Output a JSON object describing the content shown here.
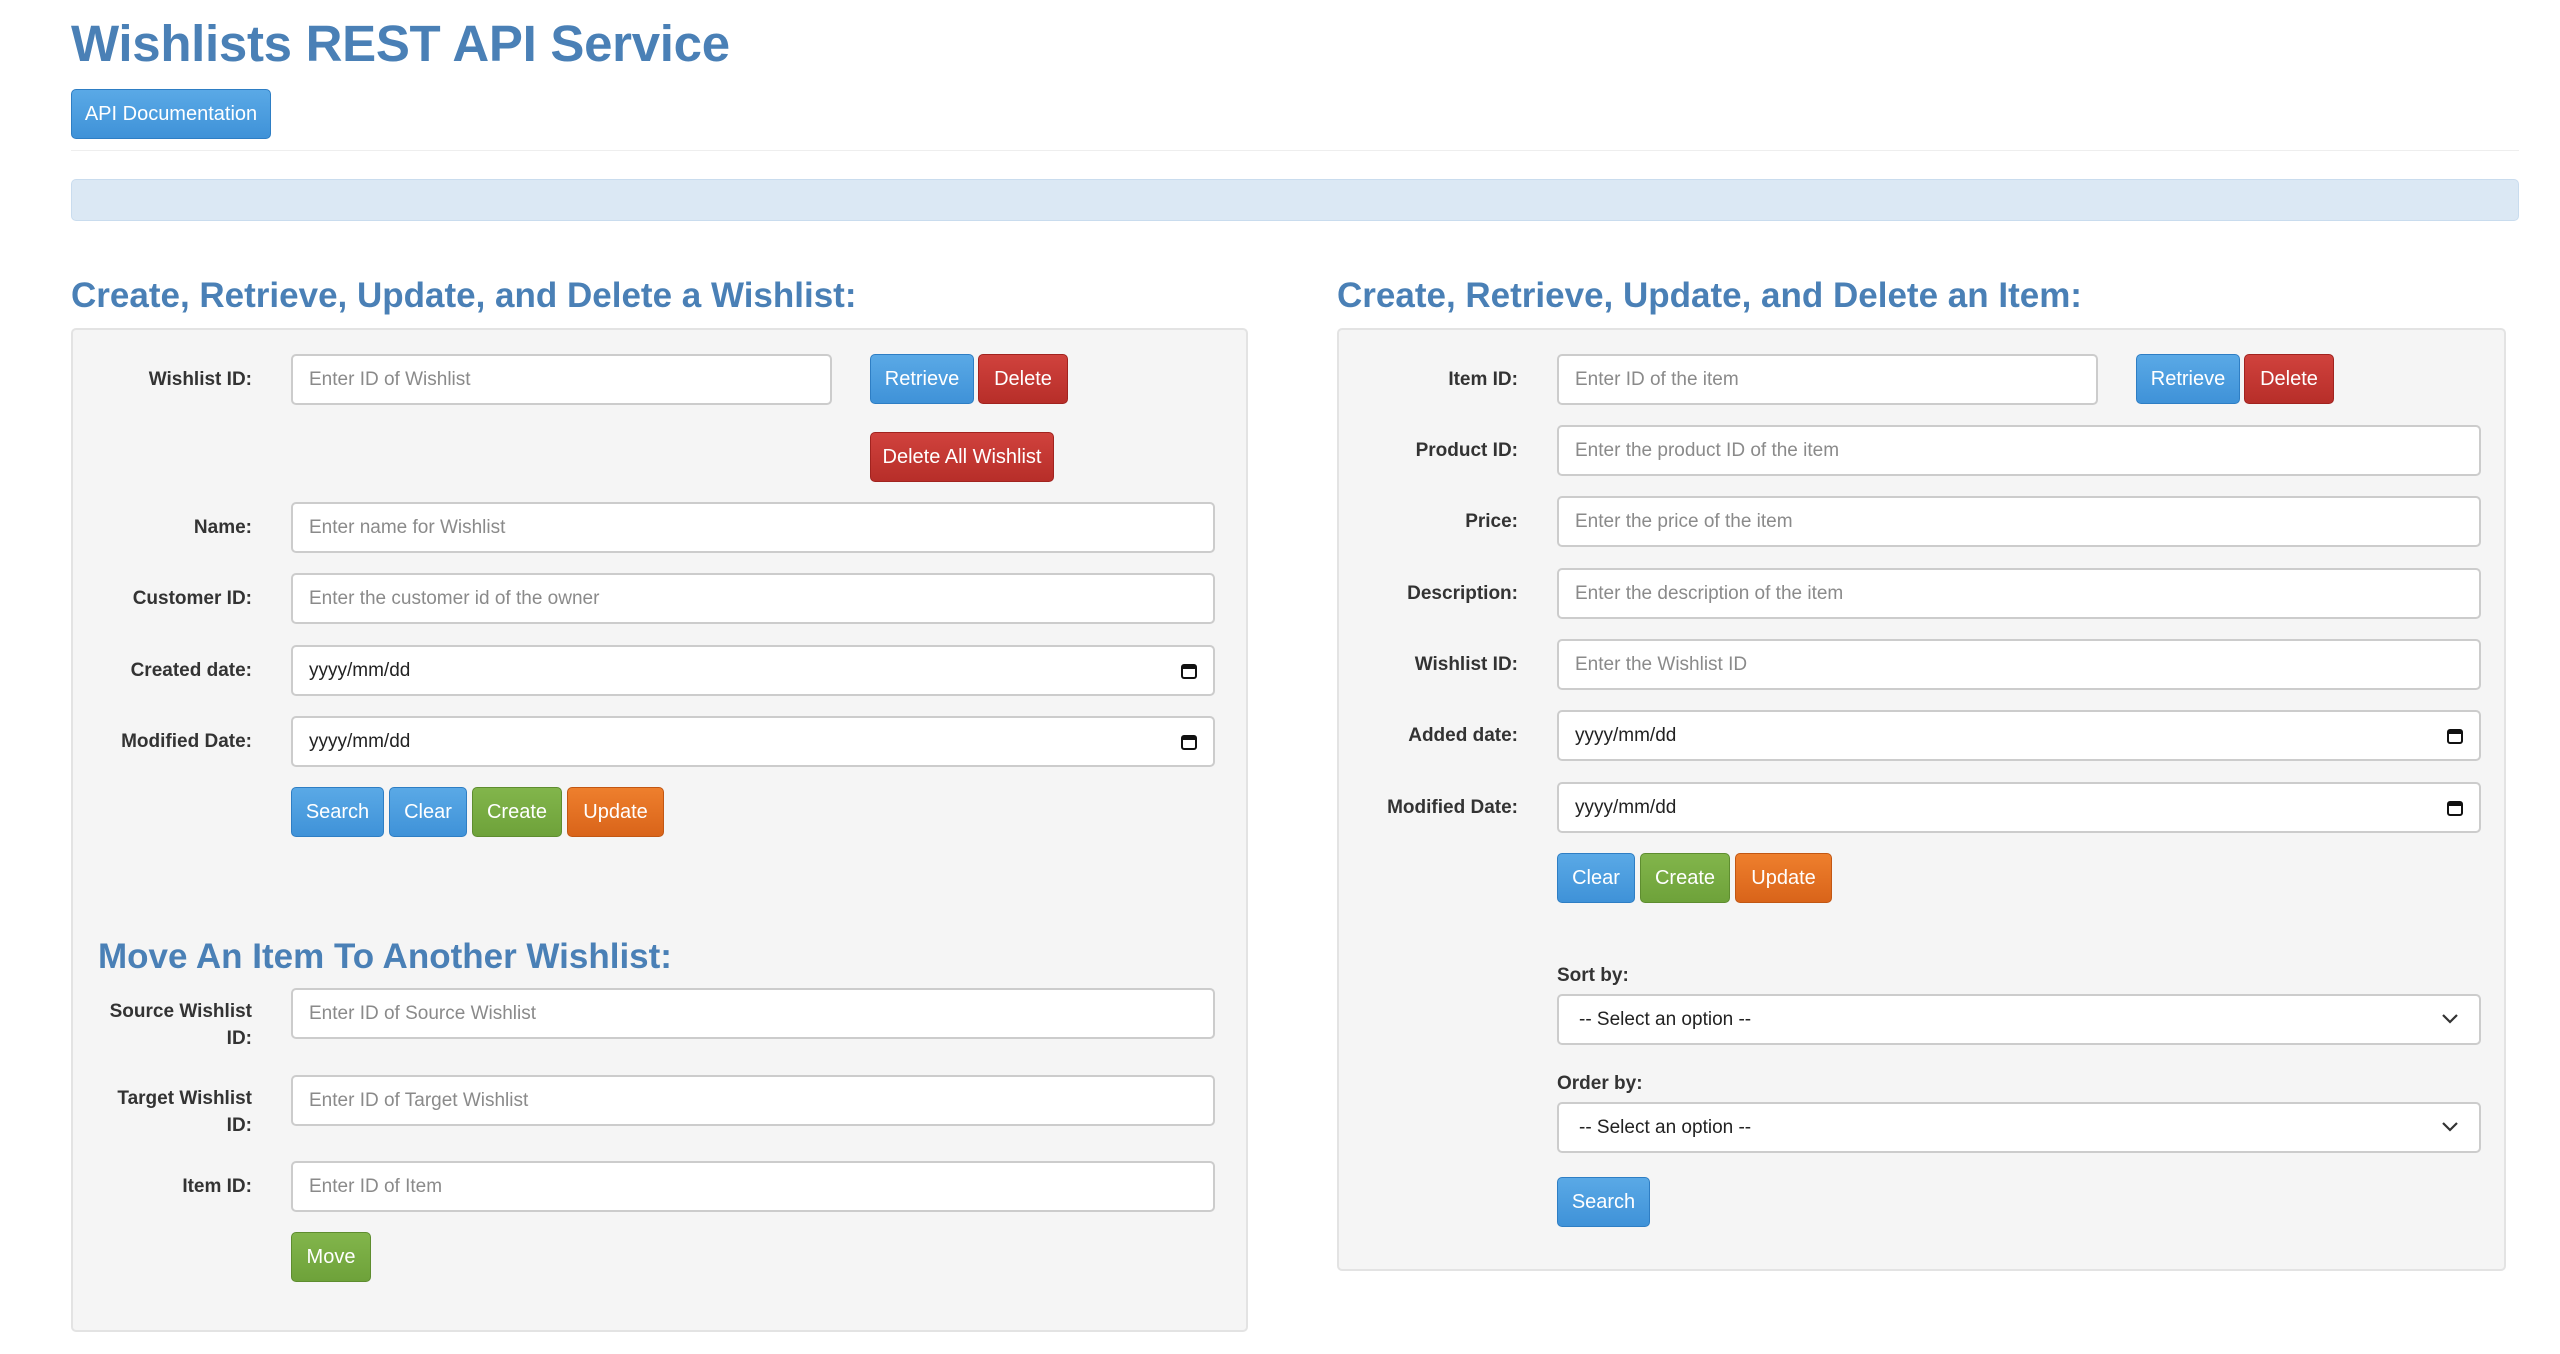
{
  "app": {
    "title": "Wishlists REST API Service",
    "api_doc_button": "API Documentation"
  },
  "wishlist_section": {
    "heading": "Create, Retrieve, Update, and Delete a Wishlist:",
    "wishlist_id": {
      "label": "Wishlist ID:",
      "placeholder": "Enter ID of Wishlist",
      "value": ""
    },
    "retrieve_button": "Retrieve",
    "delete_button": "Delete",
    "delete_all_button": "Delete All Wishlist",
    "name": {
      "label": "Name:",
      "placeholder": "Enter name for Wishlist",
      "value": ""
    },
    "customer_id": {
      "label": "Customer ID:",
      "placeholder": "Enter the customer id of the owner",
      "value": ""
    },
    "created_date": {
      "label": "Created date:",
      "value": "yyyy/mm/dd"
    },
    "modified_date": {
      "label": "Modified Date:",
      "value": "yyyy/mm/dd"
    },
    "buttons": {
      "search": "Search",
      "clear": "Clear",
      "create": "Create",
      "update": "Update"
    }
  },
  "move_section": {
    "heading": "Move An Item To Another Wishlist:",
    "source": {
      "label_line1": "Source Wishlist",
      "label_line2": "ID:",
      "placeholder": "Enter ID of Source Wishlist",
      "value": ""
    },
    "target": {
      "label_line1": "Target Wishlist",
      "label_line2": "ID:",
      "placeholder": "Enter ID of Target Wishlist",
      "value": ""
    },
    "item_id": {
      "label": "Item ID:",
      "placeholder": "Enter ID of Item",
      "value": ""
    },
    "move_button": "Move"
  },
  "item_section": {
    "heading": "Create, Retrieve, Update, and Delete an Item:",
    "item_id": {
      "label": "Item ID:",
      "placeholder": "Enter ID of the item",
      "value": ""
    },
    "retrieve_button": "Retrieve",
    "delete_button": "Delete",
    "product_id": {
      "label": "Product ID:",
      "placeholder": "Enter the product ID of the item",
      "value": ""
    },
    "price": {
      "label": "Price:",
      "placeholder": "Enter the price of the item",
      "value": ""
    },
    "description": {
      "label": "Description:",
      "placeholder": "Enter the description of the item",
      "value": ""
    },
    "wishlist_id": {
      "label": "Wishlist ID:",
      "placeholder": "Enter the Wishlist ID",
      "value": ""
    },
    "added_date": {
      "label": "Added date:",
      "value": "yyyy/mm/dd"
    },
    "modified_date": {
      "label": "Modified Date:",
      "value": "yyyy/mm/dd"
    },
    "buttons": {
      "clear": "Clear",
      "create": "Create",
      "update": "Update",
      "search": "Search"
    },
    "sort_by": {
      "label": "Sort by:",
      "selected": "-- Select an option --"
    },
    "order_by": {
      "label": "Order by:",
      "selected": "-- Select an option --"
    }
  },
  "colors": {
    "heading": "#4a80b6",
    "primary": "#3f92d8",
    "danger": "#b72e29",
    "success": "#6ea23a",
    "warning": "#d9641a",
    "flash_bg": "#dbe8f4"
  }
}
